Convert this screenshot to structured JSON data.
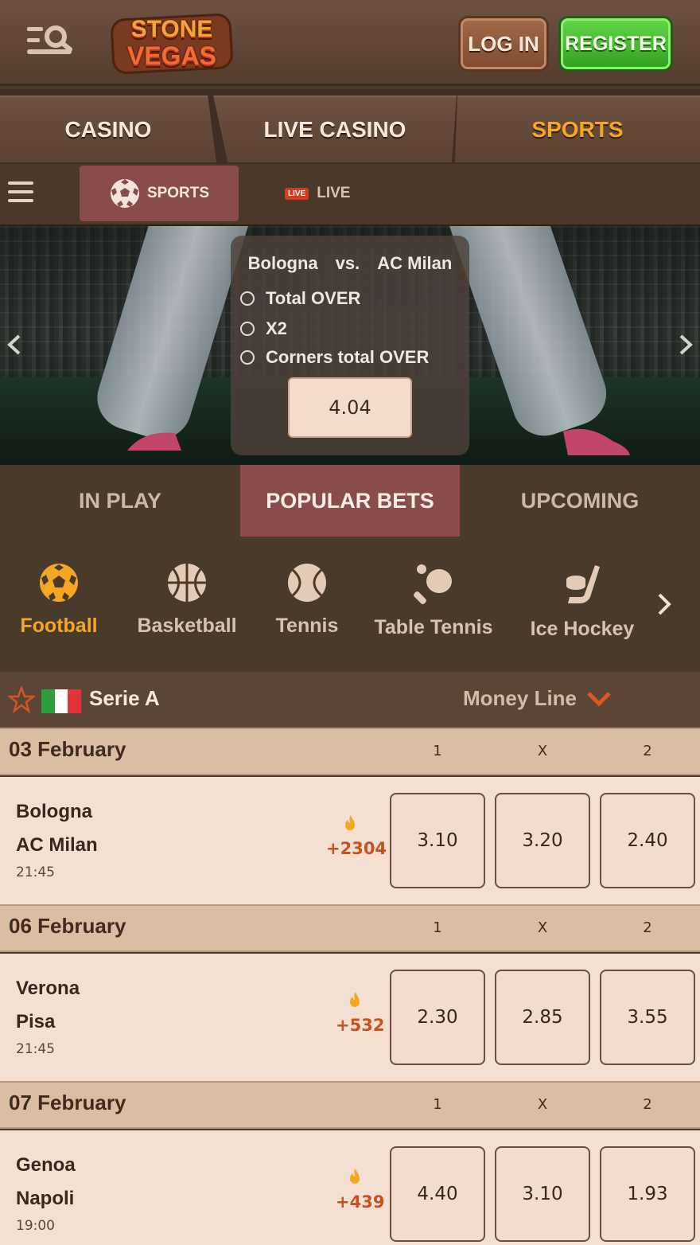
{
  "header": {
    "logo_line1": "STONE",
    "logo_line2": "VEGAS",
    "login_label": "LOG IN",
    "register_label": "REGISTER"
  },
  "main_nav": [
    {
      "label": "CASINO",
      "active": false
    },
    {
      "label": "LIVE CASINO",
      "active": false
    },
    {
      "label": "SPORTS",
      "active": true
    }
  ],
  "sub_nav": {
    "sports_label": "SPORTS",
    "live_badge": "LIVE",
    "live_label": "LIVE"
  },
  "banner": {
    "home": "Bologna",
    "vs": "vs.",
    "away": "AC Milan",
    "options": [
      "Total OVER",
      "X2",
      "Corners total OVER"
    ],
    "odds": "4.04"
  },
  "bet_tabs": [
    {
      "label": "IN PLAY",
      "active": false
    },
    {
      "label": "POPULAR BETS",
      "active": true
    },
    {
      "label": "UPCOMING",
      "active": false
    }
  ],
  "sports": [
    {
      "label": "Football",
      "icon": "football-icon",
      "active": true
    },
    {
      "label": "Basketball",
      "icon": "basketball-icon",
      "active": false
    },
    {
      "label": "Tennis",
      "icon": "tennis-icon",
      "active": false
    },
    {
      "label": "Table Tennis",
      "icon": "table-tennis-icon",
      "active": false
    },
    {
      "label": "Ice Hockey",
      "icon": "ice-hockey-icon",
      "active": false
    }
  ],
  "league": {
    "name": "Serie A",
    "market": "Money Line",
    "flag_colors": [
      "#2e9d3b",
      "#ffffff",
      "#e2353b"
    ]
  },
  "columns": [
    "1",
    "X",
    "2"
  ],
  "days": [
    {
      "date": "03 February",
      "match": {
        "home": "Bologna",
        "away": "AC Milan",
        "time": "21:45",
        "bets": "+2304",
        "odds": [
          "3.10",
          "3.20",
          "2.40"
        ]
      }
    },
    {
      "date": "06 February",
      "match": {
        "home": "Verona",
        "away": "Pisa",
        "time": "21:45",
        "bets": "+532",
        "odds": [
          "2.30",
          "2.85",
          "3.55"
        ]
      }
    },
    {
      "date": "07 February",
      "match": {
        "home": "Genoa",
        "away": "Napoli",
        "time": "19:00",
        "bets": "+439",
        "odds": [
          "4.40",
          "3.10",
          "1.93"
        ]
      }
    }
  ],
  "colors": {
    "accent": "#f5a623",
    "active_tab": "#8a4b4b",
    "register_green": "#3fb82a"
  }
}
